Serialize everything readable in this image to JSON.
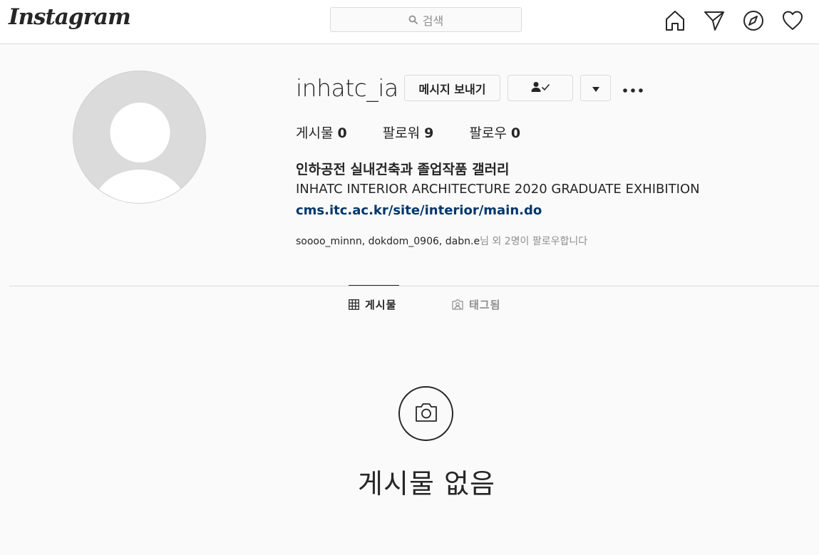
{
  "nav": {
    "logo": "Instagram",
    "search_placeholder": "검색",
    "icons": [
      "home-icon",
      "direct-send-icon",
      "explore-compass-icon",
      "activity-heart-icon"
    ]
  },
  "profile": {
    "username": "inhatc_ia",
    "message_button": "메시지 보내기",
    "following_icon": "person-check-icon",
    "dropdown_icon": "caret-down-icon",
    "more_icon": "more-dots-icon",
    "stats": {
      "posts_label": "게시물",
      "posts_value": "0",
      "followers_label": "팔로워",
      "followers_value": "9",
      "following_label": "팔로우",
      "following_value": "0"
    },
    "bio_name": "인하공전 실내건축과 졸업작품 갤러리",
    "bio_desc": "INHATC INTERIOR ARCHITECTURE 2020 GRADUATE EXHIBITION",
    "bio_link": "cms.itc.ac.kr/site/interior/main.do",
    "followed_by_names": "soooo_minnn, dokdom_0906, dabn.e",
    "followed_by_suffix": "님 외 2명이 팔로우합니다"
  },
  "tabs": {
    "posts": "게시물",
    "tagged": "태그됨"
  },
  "empty_state": {
    "icon": "camera-icon",
    "title": "게시물 없음"
  },
  "colors": {
    "background": "#fafafa",
    "border": "#dbdbdb",
    "text": "#262626",
    "muted": "#8e8e8e",
    "link": "#00376b"
  }
}
